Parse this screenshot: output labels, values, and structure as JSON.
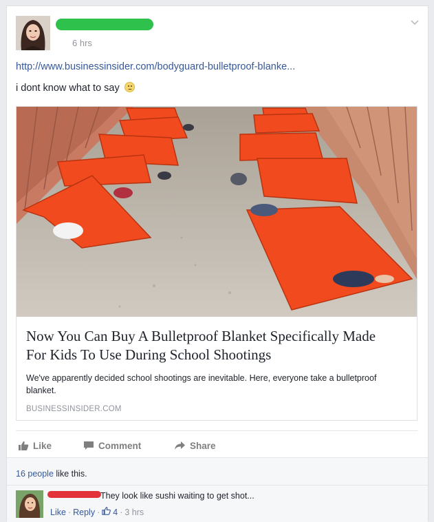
{
  "post": {
    "timestamp": "6 hrs",
    "link_url": "http://www.businessinsider.com/bodyguard-bulletproof-blanke...",
    "status_text": "i dont know what to say",
    "status_emoji": "frown-emoji"
  },
  "card": {
    "title": "Now You Can Buy A Bulletproof Blanket Specifically Made For Kids To Use During School Shootings",
    "description": "We've apparently decided school shootings are inevitable. Here, everyone take a bulletproof blanket.",
    "domain": "BUSINESSINSIDER.COM"
  },
  "actions": {
    "like": "Like",
    "comment": "Comment",
    "share": "Share"
  },
  "likes": {
    "count_link": "16 people",
    "suffix": " like this."
  },
  "comment": {
    "text": "They look like sushi waiting to get shot...",
    "like": "Like",
    "reply": "Reply",
    "sep": "·",
    "like_count": "4",
    "time": "3 hrs"
  },
  "colors": {
    "link": "#365899",
    "blanket": "#f04a1e",
    "name_redaction": "#2ec24c",
    "comment_redaction": "#e2323a"
  }
}
